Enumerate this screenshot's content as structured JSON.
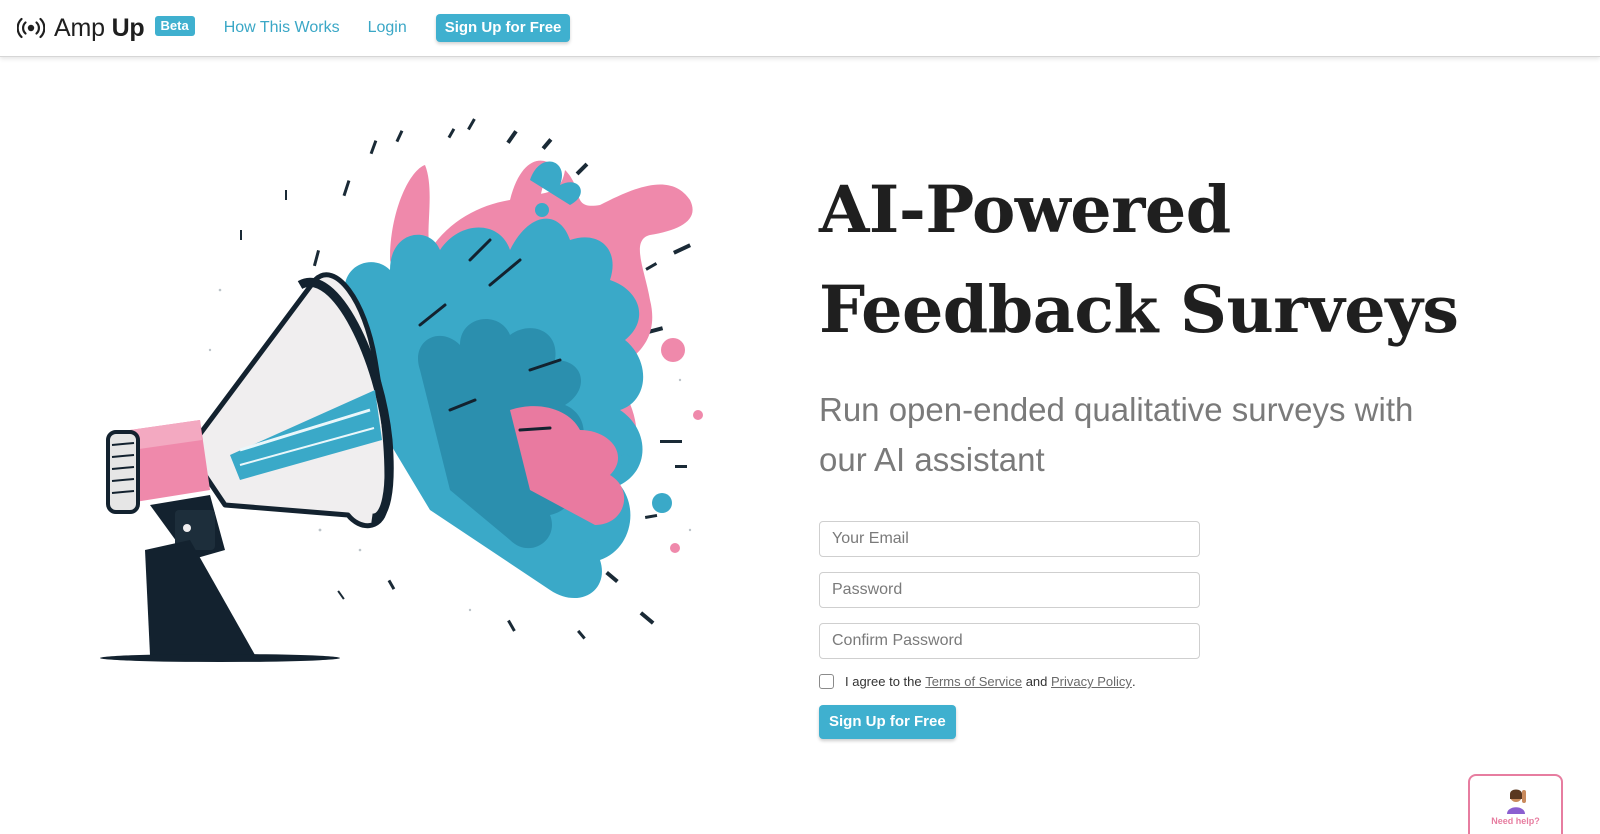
{
  "navbar": {
    "brand_light": "Amp",
    "brand_bold": "Up",
    "beta_badge": "Beta",
    "links": [
      "How This Works",
      "Login"
    ],
    "cta_label": "Sign Up for Free",
    "brand_icon": "broadcast-icon"
  },
  "hero": {
    "headline_line1": "AI-Powered",
    "headline_line2": "Feedback Surveys",
    "subhead": "Run open-ended qualitative surveys with our AI assistant",
    "image_subject": "megaphone-illustration"
  },
  "signup_form": {
    "email_placeholder": "Your Email",
    "password_placeholder": "Password",
    "confirm_placeholder": "Confirm Password",
    "agree_prefix": "I agree to the",
    "terms_link": "Terms of Service",
    "agree_middle": "and",
    "privacy_link": "Privacy Policy",
    "agree_suffix": ".",
    "submit_label": "Sign Up for Free"
  },
  "help_widget": {
    "label": "Need help?",
    "icon": "person-raising-hand-icon"
  },
  "colors": {
    "accent": "#3fb0cf",
    "pink": "#e77da0",
    "teal_art": "#3aa9c8",
    "dark": "#13222f"
  }
}
